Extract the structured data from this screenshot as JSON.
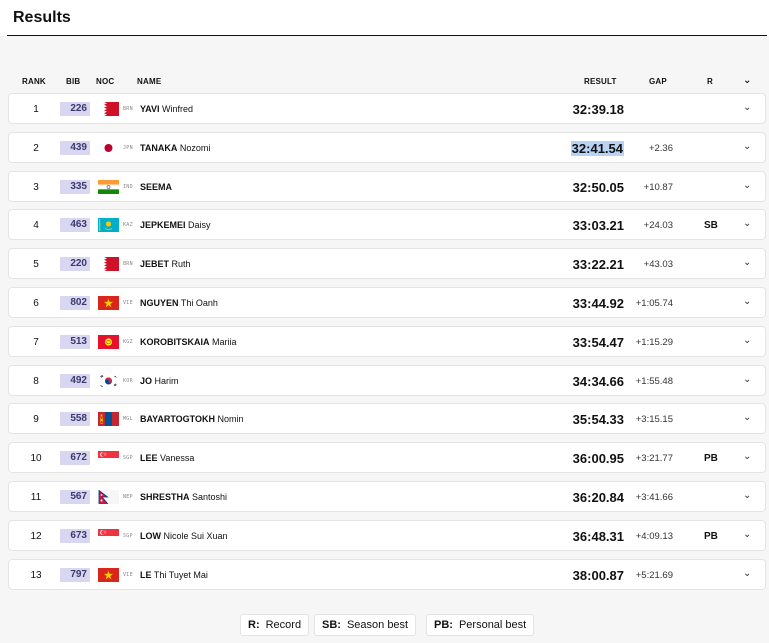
{
  "page": {
    "title": "Results"
  },
  "columns": {
    "rank": "RANK",
    "bib": "BIB",
    "noc": "NOC",
    "name": "NAME",
    "result": "RESULT",
    "gap": "GAP",
    "record": "R"
  },
  "rows": [
    {
      "rank": "1",
      "bib": "226",
      "noc": "BRN",
      "flag": "bahrain-flag-icon",
      "last": "YAVI",
      "first": "Winfred",
      "result": "32:39.18",
      "gap": "",
      "record": ""
    },
    {
      "rank": "2",
      "bib": "439",
      "noc": "JPN",
      "flag": "japan-flag-icon",
      "last": "TANAKA",
      "first": "Nozomi",
      "result": "32:41.54",
      "gap": "+2.36",
      "record": ""
    },
    {
      "rank": "3",
      "bib": "335",
      "noc": "IND",
      "flag": "india-flag-icon",
      "last": "SEEMA",
      "first": "",
      "result": "32:50.05",
      "gap": "+10.87",
      "record": ""
    },
    {
      "rank": "4",
      "bib": "463",
      "noc": "KAZ",
      "flag": "kazakhstan-flag-icon",
      "last": "JEPKEMEI",
      "first": "Daisy",
      "result": "33:03.21",
      "gap": "+24.03",
      "record": "SB"
    },
    {
      "rank": "5",
      "bib": "220",
      "noc": "BRN",
      "flag": "bahrain-flag-icon",
      "last": "JEBET",
      "first": "Ruth",
      "result": "33:22.21",
      "gap": "+43.03",
      "record": ""
    },
    {
      "rank": "6",
      "bib": "802",
      "noc": "VIE",
      "flag": "vietnam-flag-icon",
      "last": "NGUYEN",
      "first": "Thi Oanh",
      "result": "33:44.92",
      "gap": "+1:05.74",
      "record": ""
    },
    {
      "rank": "7",
      "bib": "513",
      "noc": "KGZ",
      "flag": "kyrgyzstan-flag-icon",
      "last": "KOROBITSKAIA",
      "first": "Mariia",
      "result": "33:54.47",
      "gap": "+1:15.29",
      "record": ""
    },
    {
      "rank": "8",
      "bib": "492",
      "noc": "KOR",
      "flag": "korea-flag-icon",
      "last": "JO",
      "first": "Harim",
      "result": "34:34.66",
      "gap": "+1:55.48",
      "record": ""
    },
    {
      "rank": "9",
      "bib": "558",
      "noc": "MGL",
      "flag": "mongolia-flag-icon",
      "last": "BAYARTOGTOKH",
      "first": "Nomin",
      "result": "35:54.33",
      "gap": "+3:15.15",
      "record": ""
    },
    {
      "rank": "10",
      "bib": "672",
      "noc": "SGP",
      "flag": "singapore-flag-icon",
      "last": "LEE",
      "first": "Vanessa",
      "result": "36:00.95",
      "gap": "+3:21.77",
      "record": "PB"
    },
    {
      "rank": "11",
      "bib": "567",
      "noc": "NEP",
      "flag": "nepal-flag-icon",
      "last": "SHRESTHA",
      "first": "Santoshi",
      "result": "36:20.84",
      "gap": "+3:41.66",
      "record": ""
    },
    {
      "rank": "12",
      "bib": "673",
      "noc": "SGP",
      "flag": "singapore-flag-icon",
      "last": "LOW",
      "first": "Nicole Sui Xuan",
      "result": "36:48.31",
      "gap": "+4:09.13",
      "record": "PB"
    },
    {
      "rank": "13",
      "bib": "797",
      "noc": "VIE",
      "flag": "vietnam-flag-icon",
      "last": "LE",
      "first": "Thi Tuyet Mai",
      "result": "38:00.87",
      "gap": "+5:21.69",
      "record": ""
    }
  ],
  "legend": [
    {
      "key": "R:",
      "label": "Record"
    },
    {
      "key": "SB:",
      "label": "Season best"
    },
    {
      "key": "PB:",
      "label": "Personal best"
    }
  ],
  "colors": {
    "bib_bg": "#d9d6f2",
    "selection": "#b8d4f5"
  }
}
